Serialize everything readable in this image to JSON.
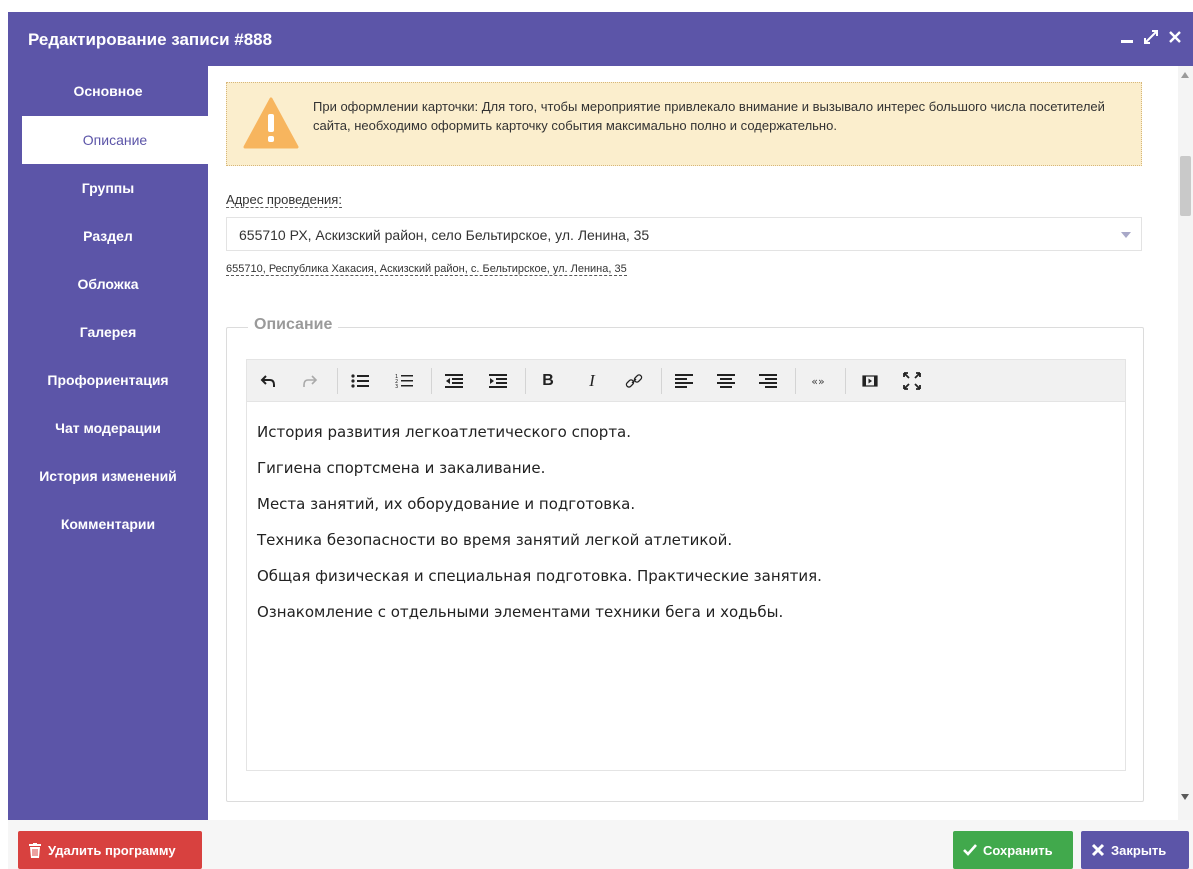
{
  "window": {
    "title": "Редактирование записи #888"
  },
  "sidebar": {
    "items": [
      {
        "label": "Основное"
      },
      {
        "label": "Описание"
      },
      {
        "label": "Группы"
      },
      {
        "label": "Раздел"
      },
      {
        "label": "Обложка"
      },
      {
        "label": "Галерея"
      },
      {
        "label": "Профориентация"
      },
      {
        "label": "Чат модерации"
      },
      {
        "label": "История изменений"
      },
      {
        "label": "Комментарии"
      }
    ],
    "active_index": 1
  },
  "warning": {
    "icon": "warning-triangle-icon",
    "text": "При оформлении карточки: Для того, чтобы мероприятие привлекало внимание и вызывало интерес большого числа посетителей сайта, необходимо оформить карточку события максимально полно и содержательно."
  },
  "address": {
    "label": "Адрес проведения:",
    "value": "655710 РХ, Аскизский район, село Бельтирское, ул. Ленина, 35",
    "hint": "655710, Республика Хакасия, Аскизский район, с. Бельтирское, ул. Ленина, 35"
  },
  "description": {
    "legend": "Описание",
    "toolbar": [
      "undo-icon",
      "redo-icon",
      "bullet-list-icon",
      "numbered-list-icon",
      "outdent-icon",
      "indent-icon",
      "bold-icon",
      "italic-icon",
      "link-icon",
      "align-left-icon",
      "align-center-icon",
      "align-right-icon",
      "blockquote-icon",
      "media-icon",
      "fullscreen-icon"
    ],
    "toolbar_text": {
      "bold": "B",
      "italic": "I",
      "quote": "«»"
    },
    "paragraphs": [
      "История развития легкоатлетического спорта.",
      "Гигиена спортсмена и закаливание.",
      "Места занятий, их оборудование и подготовка.",
      "Техника безопасности во время занятий легкой атлетикой.",
      "Общая физическая и специальная подготовка. Практические занятия.",
      "Ознакомление с отдельными элементами техники бега и ходьбы."
    ]
  },
  "footer": {
    "delete_label": "Удалить программу",
    "save_label": "Сохранить",
    "close_label": "Закрыть"
  },
  "colors": {
    "accent": "#5c55a8",
    "danger": "#d8413f",
    "success": "#41a94c",
    "warning_bg": "#fbeecd"
  }
}
